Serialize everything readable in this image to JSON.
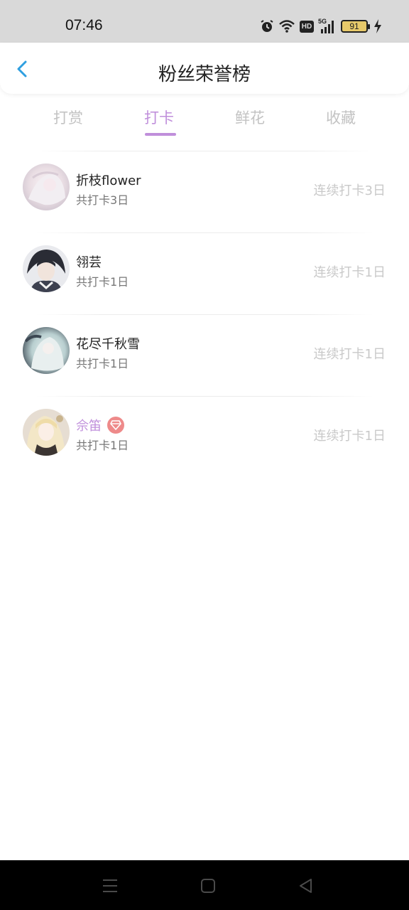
{
  "status_bar": {
    "time": "07:46",
    "network": "5G",
    "hd": "HD",
    "battery": "91"
  },
  "header": {
    "title": "粉丝荣誉榜"
  },
  "tabs": [
    {
      "label": "打赏",
      "active": false
    },
    {
      "label": "打卡",
      "active": true
    },
    {
      "label": "鲜花",
      "active": false
    },
    {
      "label": "收藏",
      "active": false
    }
  ],
  "rows": [
    {
      "name": "折枝flower",
      "total": "共打卡3日",
      "streak": "连续打卡3日",
      "vip": false
    },
    {
      "name": "翎芸",
      "total": "共打卡1日",
      "streak": "连续打卡1日",
      "vip": false
    },
    {
      "name": "花尽千秋雪",
      "total": "共打卡1日",
      "streak": "连续打卡1日",
      "vip": false
    },
    {
      "name": "佘笛",
      "total": "共打卡1日",
      "streak": "连续打卡1日",
      "vip": true
    }
  ],
  "colors": {
    "accent": "#c08fdb",
    "back_arrow": "#2f9fe0",
    "vip_badge": "#ee8a8a",
    "status_bar_bg": "#d9d9d9"
  }
}
